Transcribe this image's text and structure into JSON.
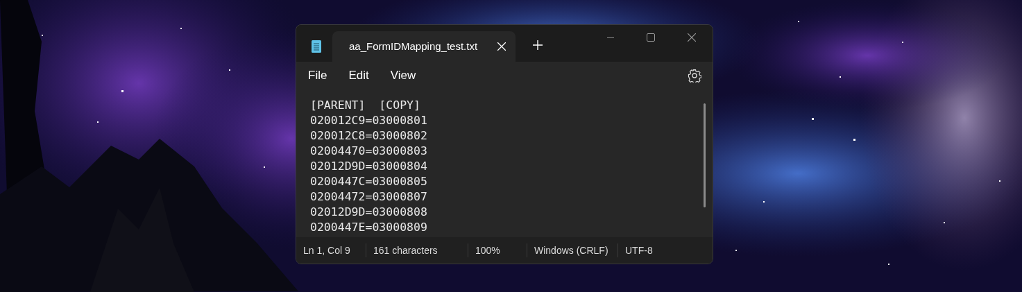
{
  "tabs": [
    {
      "label": "aa_FormIDMapping_test.txt",
      "selected": true
    }
  ],
  "menu": [
    "File",
    "Edit",
    "View"
  ],
  "lines": [
    "[PARENT]  [COPY]",
    "020012C9=03000801",
    "020012C8=03000802",
    "02004470=03000803",
    "02012D9D=03000804",
    "0200447C=03000805",
    "02004472=03000807",
    "02012D9D=03000808",
    "0200447E=03000809"
  ],
  "status_bar": [
    "Ln 1, Col 9",
    "161 characters",
    "100%",
    "Windows (CRLF)",
    "UTF-8"
  ]
}
